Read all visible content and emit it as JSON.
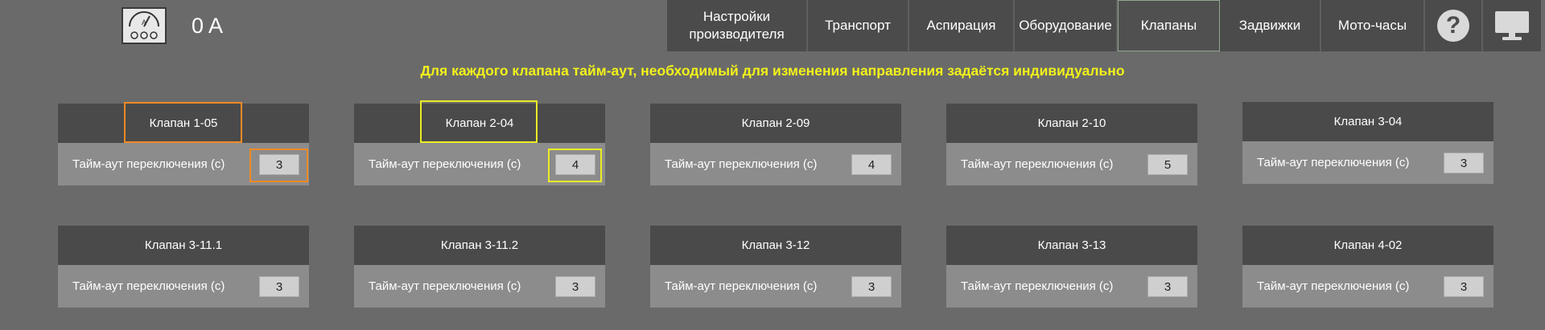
{
  "header": {
    "ammeter_icon": "ammeter-icon",
    "ammeter_letter": "A",
    "current_value": "0 A"
  },
  "nav": {
    "tabs": [
      {
        "label_line1": "Настройки",
        "label_line2": "производителя"
      },
      {
        "label": "Транспорт"
      },
      {
        "label": "Аспирация"
      },
      {
        "label": "Оборудование"
      },
      {
        "label": "Клапаны",
        "active": true
      },
      {
        "label": "Задвижки"
      },
      {
        "label": "Мото-часы"
      }
    ],
    "help_icon": "help-icon",
    "help_glyph": "?",
    "monitor_icon": "monitor-icon"
  },
  "notice": "Для каждого клапана тайм-аут, необходимый для изменения направления задаётся индивидуально",
  "valves": [
    {
      "name": "Клапан  1-05",
      "label": "Тайм-аут переключения (с)",
      "value": "3",
      "highlight": "orange"
    },
    {
      "name": "Клапан  2-04",
      "label": "Тайм-аут переключения (с)",
      "value": "4",
      "highlight": "yellow"
    },
    {
      "name": "Клапан  2-09",
      "label": "Тайм-аут переключения (с)",
      "value": "4"
    },
    {
      "name": "Клапан  2-10",
      "label": "Тайм-аут переключения (с)",
      "value": "5"
    },
    {
      "name": "Клапан  3-04",
      "label": "Тайм-аут переключения (с)",
      "value": "3"
    },
    {
      "name": "Клапан  3-11.1",
      "label": "Тайм-аут переключения (с)",
      "value": "3"
    },
    {
      "name": "Клапан  3-11.2",
      "label": "Тайм-аут переключения (с)",
      "value": "3"
    },
    {
      "name": "Клапан  3-12",
      "label": "Тайм-аут переключения (с)",
      "value": "3"
    },
    {
      "name": "Клапан  3-13",
      "label": "Тайм-аут переключения (с)",
      "value": "3"
    },
    {
      "name": "Клапан  4-02",
      "label": "Тайм-аут переключения (с)",
      "value": "3"
    }
  ],
  "colors": {
    "background": "#6a6a6a",
    "accent_notice": "#f2f21a",
    "highlight_orange": "#f08a24",
    "highlight_yellow": "#ebeb25"
  }
}
